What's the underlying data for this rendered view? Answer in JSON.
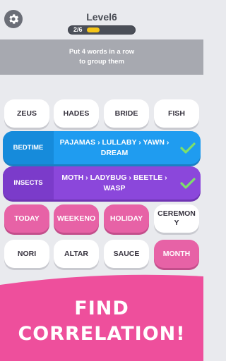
{
  "header": {
    "level_title": "Level6",
    "progress_text": "2/6",
    "progress_fraction": 0.33
  },
  "hint": {
    "line1": "Put 4 words in a row",
    "line2": "to group them"
  },
  "rows": {
    "row1": [
      "ZEUS",
      "HADES",
      "BRIDE",
      "FISH"
    ],
    "row4": [
      "TODAY",
      "WEEKENO",
      "HOLIDAY",
      "CEREMON\nY"
    ],
    "row5": [
      "NORI",
      "ALTAR",
      "SAUCE",
      "MONTH"
    ]
  },
  "groups": [
    {
      "name": "BEDTIME",
      "words_line1": "PAJAMAS › LULLABY › YAWN ›",
      "words_line2": "DREAM",
      "color": "#1f9cf0"
    },
    {
      "name": "INSECTS",
      "words_line1": "MOTH › LADYBUG › BEETLE ›",
      "words_line2": "WASP",
      "color": "#8b47db"
    }
  ],
  "banner": {
    "line1": "FIND",
    "line2": "CORRELATION!",
    "color": "#ee4f9c"
  },
  "icons": {
    "settings": "gear-icon",
    "solved": "check-icon"
  }
}
